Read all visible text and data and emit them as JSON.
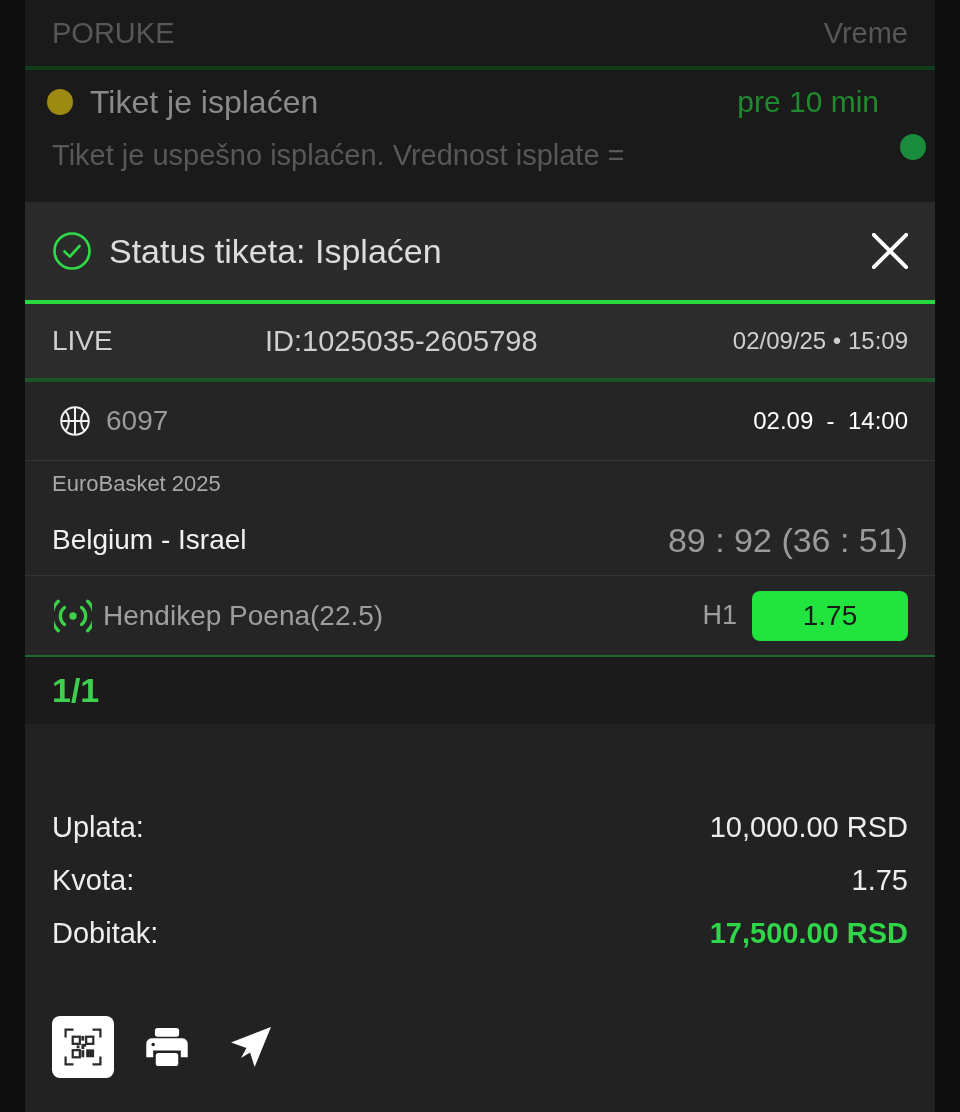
{
  "background_list": {
    "columns": [
      "PORUKE",
      "Vreme"
    ],
    "messages": [
      {
        "title": "Tiket je isplaćen",
        "time": "pre 10 min",
        "body": "Tiket je uspešno isplaćen. Vrednost isplate =",
        "color": "#9c8a12",
        "unread": true
      }
    ]
  },
  "modal": {
    "title": "Status tiketa: Isplaćen",
    "ticket": {
      "type": "LIVE",
      "id": "ID:1025035-2605798",
      "datetime": "02/09/25 • 15:09"
    },
    "events": [
      {
        "kind": "basketball",
        "code": "6097",
        "start": "02.09  -  14:00",
        "league": "EuroBasket 2025",
        "match": "Belgium - Israel",
        "score": "89 : 92 (36 : 51)",
        "live": true,
        "market": "Hendikep Poena(22.5)",
        "pick": "H1",
        "odds": "1.75"
      }
    ],
    "count": "1/1",
    "summary": [
      {
        "label": "Uplata:",
        "value": "10,000.00 RSD",
        "highlight": false
      },
      {
        "label": "Kvota:",
        "value": "1.75",
        "highlight": false
      },
      {
        "label": "Dobitak:",
        "value": "17,500.00 RSD",
        "highlight": true
      }
    ],
    "actions": [
      {
        "kind": "qr",
        "selected": true
      },
      {
        "kind": "print",
        "selected": false
      },
      {
        "kind": "send",
        "selected": false
      }
    ]
  }
}
